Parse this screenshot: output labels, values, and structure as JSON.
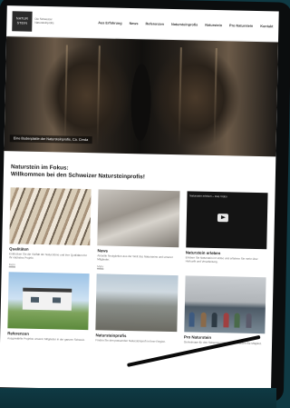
{
  "header": {
    "logo_line1": "NATUR",
    "logo_line2": "STEIN",
    "logo_tagline": "Die Schweizer Natursteinprofis",
    "nav": [
      "Aus Erfahrung",
      "News",
      "Referenzen",
      "Natursteinprofis",
      "Naturstein",
      "Pro Naturstein",
      "Kontakt"
    ]
  },
  "hero": {
    "caption": "Eine Bodenplatte der Natursteinprofis, Ca. Cerda"
  },
  "intro": {
    "heading_line1": "Naturstein im Fokus:",
    "heading_line2": "Willkommen bei den Schweizer Natursteinprofis!"
  },
  "cards": [
    {
      "title": "Qualitäten",
      "text": "Entdecken Sie die Vielfalt der Natursteine und ihre Qualitäten für Ihr nächstes Projekt.",
      "more": "Mehr"
    },
    {
      "title": "News",
      "text": "Aktuelle Neuigkeiten aus der Welt des Natursteins und unserer Mitglieder.",
      "more": "Mehr"
    },
    {
      "title": "Naturstein erleben",
      "text": "Erleben Sie Naturstein im Video und erfahren Sie mehr über Herkunft und Verarbeitung.",
      "more": "",
      "video_title": "Naturstein erleben – Das Video"
    },
    {
      "title": "Referenzen",
      "text": "Ausgewählte Projekte unserer Mitglieder in der ganzen Schweiz.",
      "more": ""
    },
    {
      "title": "Natursteinprofis",
      "text": "Finden Sie den passenden Natursteinprofi in Ihrer Region.",
      "more": ""
    },
    {
      "title": "Pro Naturstein",
      "text": "Gemeinsam für den Schweizer Naturstein – werden Sie Mitglied.",
      "more": ""
    }
  ]
}
